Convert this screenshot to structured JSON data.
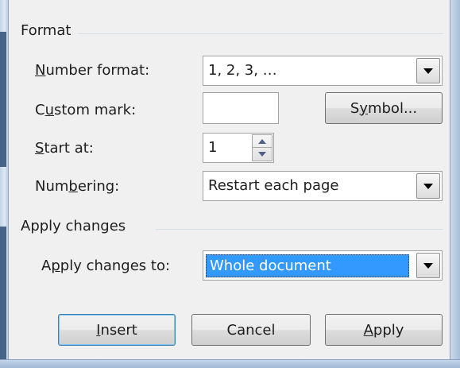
{
  "format_group": {
    "title": "Format",
    "number_format": {
      "label_u": "N",
      "label_rest": "umber format:",
      "value": "1, 2, 3, …"
    },
    "custom_mark": {
      "label_pre": "C",
      "label_u": "u",
      "label_rest": "stom mark:",
      "value": ""
    },
    "symbol_button": {
      "pre": "S",
      "u": "y",
      "rest": "mbol..."
    },
    "start_at": {
      "label_u": "S",
      "label_rest": "tart at:",
      "value": "1"
    },
    "numbering": {
      "label_pre": "Num",
      "label_u": "b",
      "label_rest": "ering:",
      "value": "Restart each page"
    }
  },
  "apply_group": {
    "title": "Apply changes",
    "apply_to": {
      "label_pre": "A",
      "label_u": "p",
      "label_rest": "ply changes to:",
      "value": "Whole document"
    }
  },
  "buttons": {
    "insert": {
      "u": "I",
      "rest": "nsert"
    },
    "cancel": {
      "label": "Cancel"
    },
    "apply": {
      "u": "A",
      "rest": "pply"
    }
  },
  "colors": {
    "panel_bg": "#f0f0f0",
    "selection": "#3399ff",
    "default_button_border": "#3c7fb1"
  }
}
